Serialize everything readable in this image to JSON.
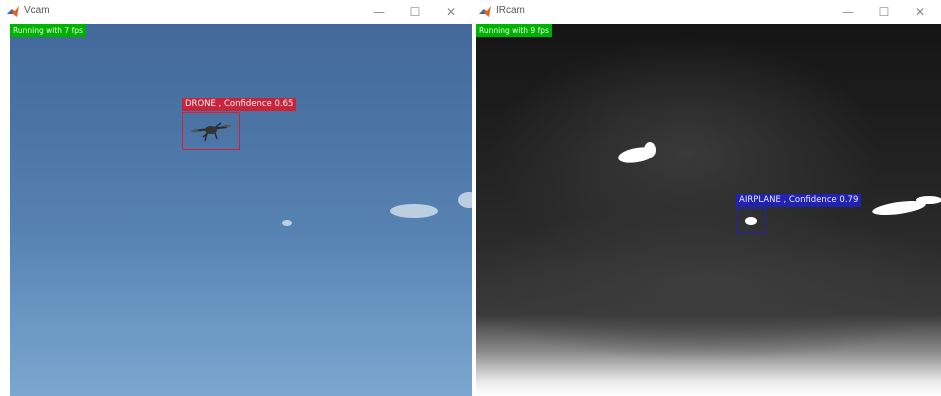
{
  "vcam": {
    "title": "Vcam",
    "fps_text": "Running with 7 fps",
    "detection": {
      "label": "DRONE , Confidence 0.65",
      "color": "#c8243a"
    },
    "window_controls": {
      "minimize": "—",
      "maximize": "☐",
      "close": "✕"
    }
  },
  "ircam": {
    "title": "IRcam",
    "fps_text": "Running with 9 fps",
    "detection": {
      "label": "AIRPLANE , Confidence 0.79",
      "color": "#2222b0"
    },
    "window_controls": {
      "minimize": "—",
      "maximize": "☐",
      "close": "✕"
    }
  },
  "colors": {
    "fps_badge": "#00b200",
    "app_icon": "#e8632a"
  },
  "icons": {
    "app": "matlab-icon"
  }
}
